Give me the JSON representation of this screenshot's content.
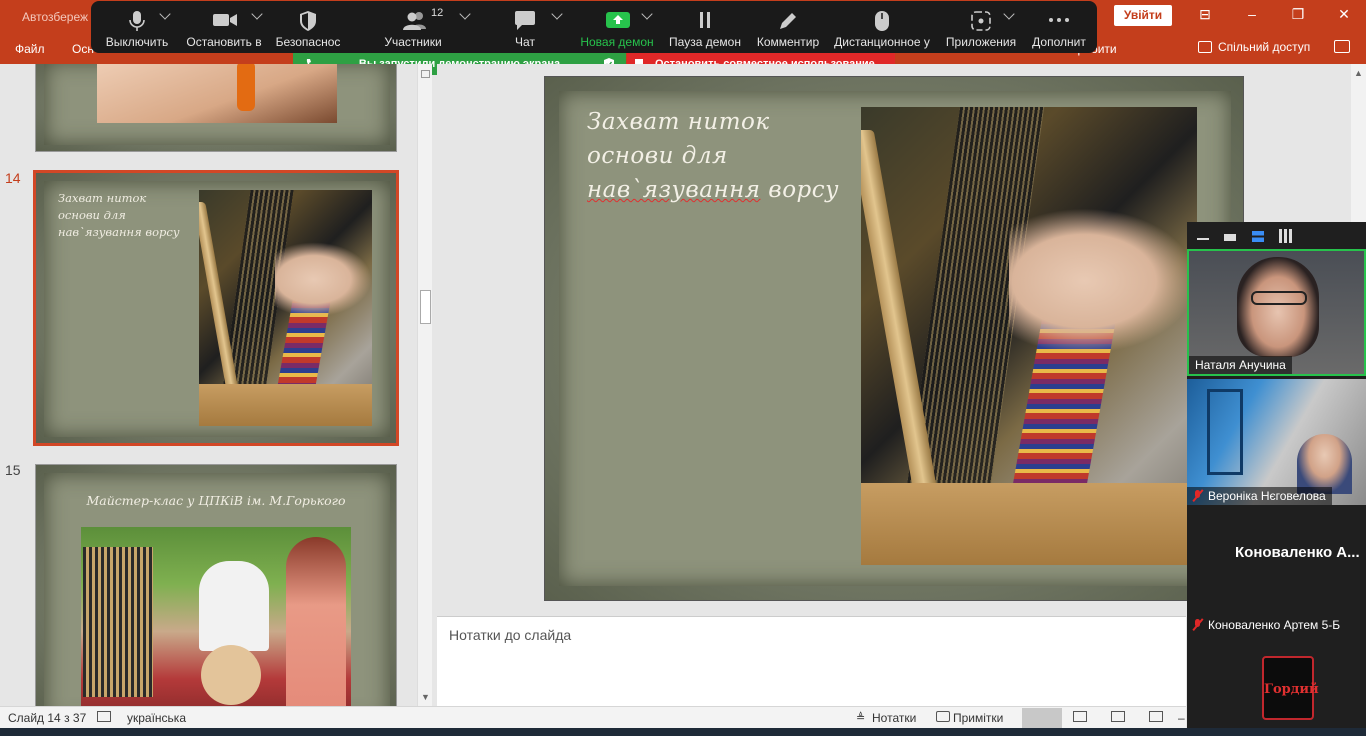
{
  "pp": {
    "autosave": "Автозбереж",
    "tabs": [
      "Файл",
      "Осн"
    ],
    "ribbon_right": "зробити",
    "signin": "Увійти",
    "share": "Спільний доступ"
  },
  "zoom": {
    "tools": [
      {
        "label": "Выключить",
        "icon": "microphone-icon"
      },
      {
        "label": "Остановить в",
        "icon": "video-camera-icon"
      },
      {
        "label": "Безопаснос",
        "icon": "shield-icon"
      },
      {
        "label": "Участники",
        "icon": "participants-icon",
        "count": "12"
      },
      {
        "label": "Чат",
        "icon": "chat-icon"
      },
      {
        "label": "Новая демон",
        "icon": "share-screen-icon"
      },
      {
        "label": "Пауза демон",
        "icon": "pause-icon"
      },
      {
        "label": "Комментир",
        "icon": "pen-icon"
      },
      {
        "label": "Дистанционное у",
        "icon": "mouse-icon"
      },
      {
        "label": "Приложения",
        "icon": "apps-icon"
      },
      {
        "label": "Дополнит",
        "icon": "more-icon"
      }
    ],
    "banner_green": "Вы запустили демонстрацию экрана",
    "banner_red": "Остановить совместное использование"
  },
  "thumbs": {
    "n14": "14",
    "n15": "15",
    "t14_title": "Захват ниток основи для нав`язування ворсу",
    "t15_title": "Майстер-клас  у  ЦПКіВ  ім. М.Горького"
  },
  "slide": {
    "title_l1": "Захват ниток",
    "title_l2": "основи для",
    "title_l3a": "нав`язування",
    "title_l3b": " ворсу"
  },
  "notes": {
    "placeholder": "Нотатки до слайда"
  },
  "status": {
    "slide": "Слайд 14 з 37",
    "lang": "українська",
    "notes": "Нотатки",
    "comments": "Примітки"
  },
  "video": {
    "p1": "Наталя Анучина",
    "p2": "Вероніка Нєговелова",
    "p3_big": "Коноваленко  А...",
    "p3": "Коноваленко Артем 5-Б",
    "p4_logo": "Гордий"
  },
  "colors": {
    "pp_red": "#c43e1c",
    "zoom_green": "#2ea043",
    "zoom_red": "#e02828"
  }
}
